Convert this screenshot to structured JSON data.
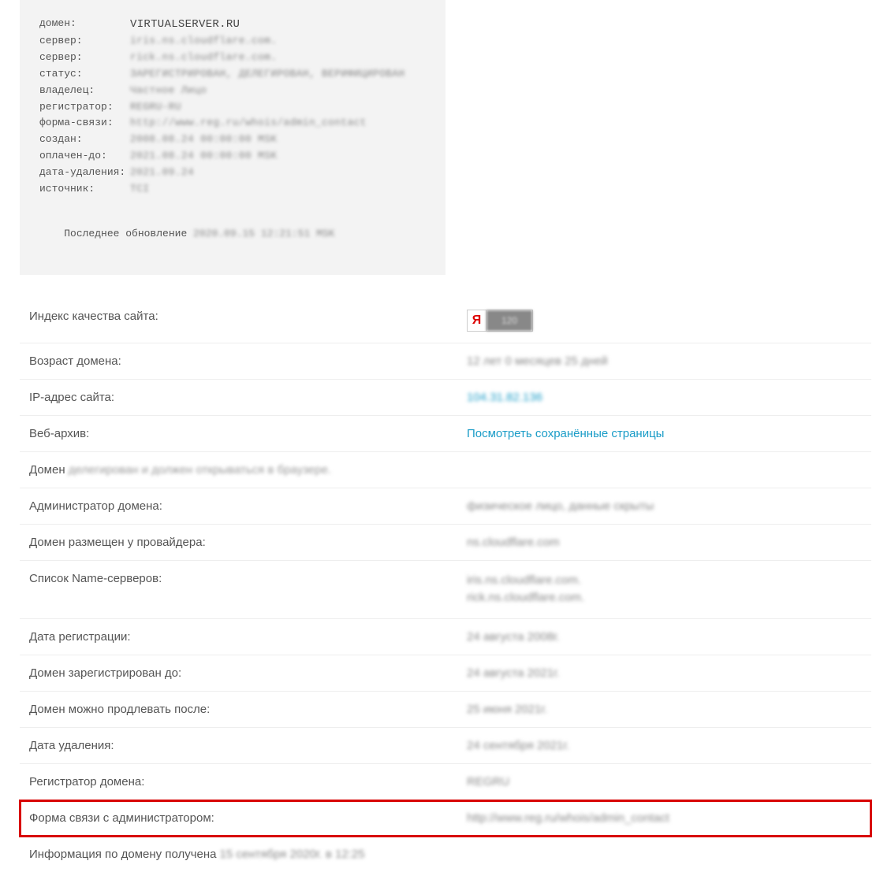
{
  "whois": {
    "rows": [
      {
        "label": "домен:",
        "value": "VIRTUALSERVER.RU",
        "clear": true
      },
      {
        "label": "сервер:",
        "value": "iris.ns.cloudflare.com."
      },
      {
        "label": "сервер:",
        "value": "rick.ns.cloudflare.com."
      },
      {
        "label": "статус:",
        "value": "ЗАРЕГИСТРИРОВАН, ДЕЛЕГИРОВАН, ВЕРИФИЦИРОВАН"
      },
      {
        "label": "владелец:",
        "value": "Частное Лицо"
      },
      {
        "label": "регистратор:",
        "value": "REGRU-RU"
      },
      {
        "label": "форма-связи:",
        "value": "http://www.reg.ru/whois/admin_contact"
      },
      {
        "label": "создан:",
        "value": "2008.08.24 00:00:00 MSK"
      },
      {
        "label": "оплачен-до:",
        "value": "2021.08.24 00:00:00 MSK"
      },
      {
        "label": "дата-удаления:",
        "value": "2021.09.24"
      },
      {
        "label": "источник:",
        "value": "TCI"
      }
    ],
    "footer_label": "Последнее обновление ",
    "footer_value": "2020.09.15 12:21:51 MSK"
  },
  "yandex": {
    "letter": "Я",
    "score": "120"
  },
  "rows": {
    "quality_label": "Индекс качества сайта:",
    "age_label": "Возраст домена:",
    "age_value": "12 лет 0 месяцев 25 дней",
    "ip_label": "IP-адрес сайта:",
    "ip_value": "104.31.82.136",
    "archive_label": "Веб-архив:",
    "archive_value": "Посмотреть сохранённые страницы",
    "delegated_prefix": "Домен ",
    "delegated_suffix": "делегирован и должен открываться в браузере.",
    "admin_label": "Администратор домена:",
    "admin_value": "физическое лицо, данные скрыты",
    "provider_label": "Домен размещен у провайдера:",
    "provider_value": "ns.cloudflare.com",
    "ns_label": "Список Name-серверов:",
    "ns1": "iris.ns.cloudflare.com.",
    "ns2": "rick.ns.cloudflare.com.",
    "regdate_label": "Дата регистрации:",
    "regdate_value": "24 августа 2008г.",
    "paid_label": "Домен зарегистрирован до:",
    "paid_value": "24 августа 2021г.",
    "renew_label": "Домен можно продлевать после:",
    "renew_value": "25 июня 2021г.",
    "del_label": "Дата удаления:",
    "del_value": "24 сентября 2021г.",
    "registrar_label": "Регистратор домена:",
    "registrar_value": "REGRU",
    "contact_label": "Форма связи с администратором:",
    "contact_value": "http://www.reg.ru/whois/admin_contact",
    "obtained_prefix": "Информация по домену получена",
    "obtained_value": "15 сентября 2020г. в 12:25"
  }
}
